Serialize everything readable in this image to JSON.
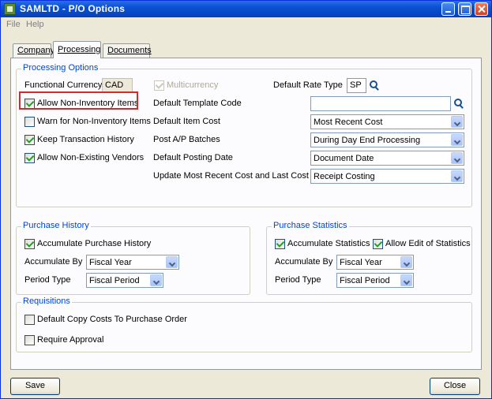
{
  "window": {
    "title": "SAMLTD - P/O Options"
  },
  "menu": {
    "file": "File",
    "help": "Help"
  },
  "tabs": [
    {
      "label": "Company",
      "active": false
    },
    {
      "label": "Processing",
      "active": true
    },
    {
      "label": "Documents",
      "active": false
    }
  ],
  "processing_options": {
    "title": "Processing Options",
    "functional_currency_label": "Functional Currency",
    "functional_currency_value": "CAD",
    "multicurrency_label": "Multicurrency",
    "default_rate_type_label": "Default Rate Type",
    "default_rate_type_value": "SP",
    "checkboxes": [
      {
        "label": "Allow Non-Inventory Items",
        "checked": true
      },
      {
        "label": "Warn for Non-Inventory Items",
        "checked": false
      },
      {
        "label": "Keep Transaction History",
        "checked": true
      },
      {
        "label": "Allow Non-Existing Vendors",
        "checked": true
      }
    ],
    "default_template_code_label": "Default Template Code",
    "default_template_code_value": "",
    "default_item_cost_label": "Default Item Cost",
    "default_item_cost_value": "Most Recent Cost",
    "post_ap_batches_label": "Post A/P Batches",
    "post_ap_batches_value": "During Day End Processing",
    "default_posting_date_label": "Default Posting Date",
    "default_posting_date_value": "Document Date",
    "update_cost_label": "Update Most Recent Cost and Last Cost At",
    "update_cost_value": "Receipt Costing"
  },
  "purchase_history": {
    "title": "Purchase History",
    "accumulate_label": "Accumulate Purchase History",
    "accumulate_checked": true,
    "accumulate_by_label": "Accumulate By",
    "accumulate_by_value": "Fiscal Year",
    "period_type_label": "Period Type",
    "period_type_value": "Fiscal Period"
  },
  "purchase_statistics": {
    "title": "Purchase Statistics",
    "accumulate_label": "Accumulate Statistics",
    "accumulate_checked": true,
    "allow_edit_label": "Allow Edit of Statistics",
    "allow_edit_checked": true,
    "accumulate_by_label": "Accumulate By",
    "accumulate_by_value": "Fiscal Year",
    "period_type_label": "Period Type",
    "period_type_value": "Fiscal Period"
  },
  "requisitions": {
    "title": "Requisitions",
    "default_copy_label": "Default Copy Costs To Purchase Order",
    "default_copy_checked": false,
    "require_approval_label": "Require Approval",
    "require_approval_checked": false
  },
  "buttons": {
    "save": "Save",
    "close": "Close"
  },
  "colors": {
    "title_bar": "#0a4fd4",
    "group_title": "#0046d5",
    "highlight": "#d32b2b",
    "dialog_bg": "#ece9d8"
  },
  "icons": {
    "finder": "magnifier-icon",
    "dropdown": "chevron-down-icon"
  }
}
